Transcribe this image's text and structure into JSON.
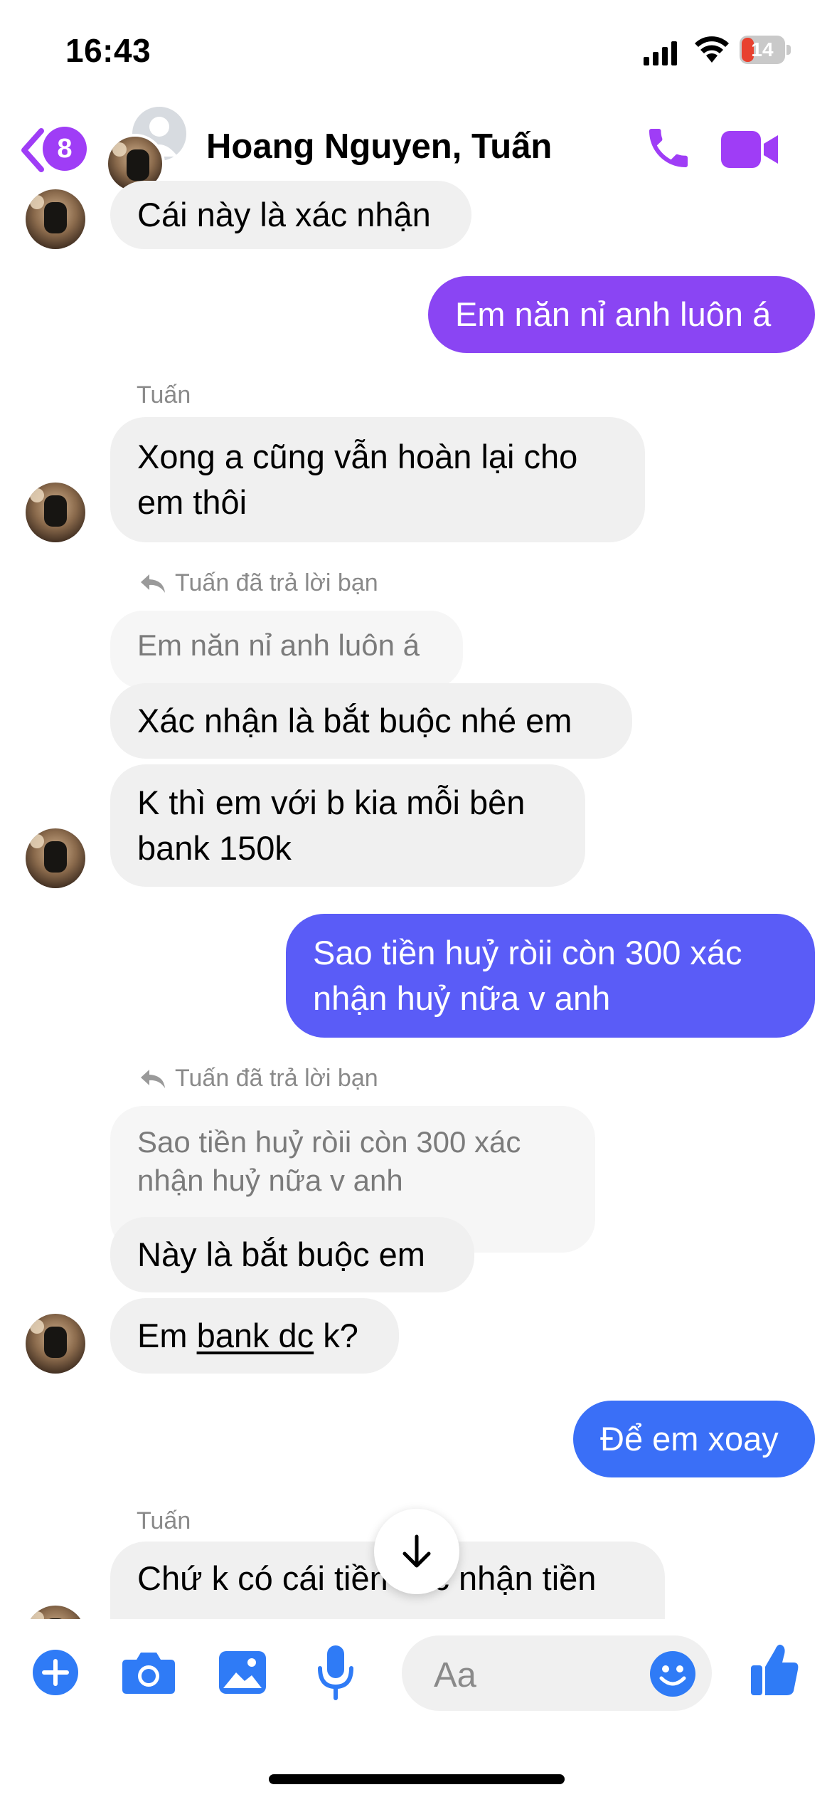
{
  "status_bar": {
    "time": "16:43",
    "battery": "14"
  },
  "header": {
    "back_badge": "8",
    "title": "Hoang Nguyen, Tuấn"
  },
  "messages": {
    "m1": "Cái này là xác nhận",
    "m2": "Em năn nỉ anh luôn á",
    "sender1": "Tuấn",
    "m3_l1": "Xong a cũng vẫn hoàn lại cho",
    "m3_l2": "em thôi",
    "reply1_label": "Tuấn đã trả lời bạn",
    "reply1_quote": "Em năn nỉ anh luôn á",
    "m4": "Xác nhận là bắt buộc nhé em",
    "m5_l1": "K thì em với b kia mỗi bên",
    "m5_l2": "bank 150k",
    "m6_l1": "Sao tiền huỷ ròii còn 300 xác",
    "m6_l2": "nhận huỷ nữa v anh",
    "reply2_label": "Tuấn đã trả lời bạn",
    "reply2_quote_l1": "Sao tiền huỷ ròii còn 300 xác",
    "reply2_quote_l2": "nhận huỷ nữa v anh",
    "m7": "Này là bắt buộc em",
    "m8_pre": "Em ",
    "m8_link": "bank dc",
    "m8_post": " k?",
    "m9": "Để em xoay",
    "sender2": "Tuấn",
    "m10": "Chứ k có cái tiền xác nhận tiền"
  },
  "composer": {
    "placeholder": "Aa"
  },
  "colors": {
    "accent": "#9f3df6",
    "out_purple": "#8a45f3",
    "out_indigo": "#5a5cf7",
    "out_blue": "#3a6ff7",
    "icon_blue": "#2f7bf6"
  }
}
